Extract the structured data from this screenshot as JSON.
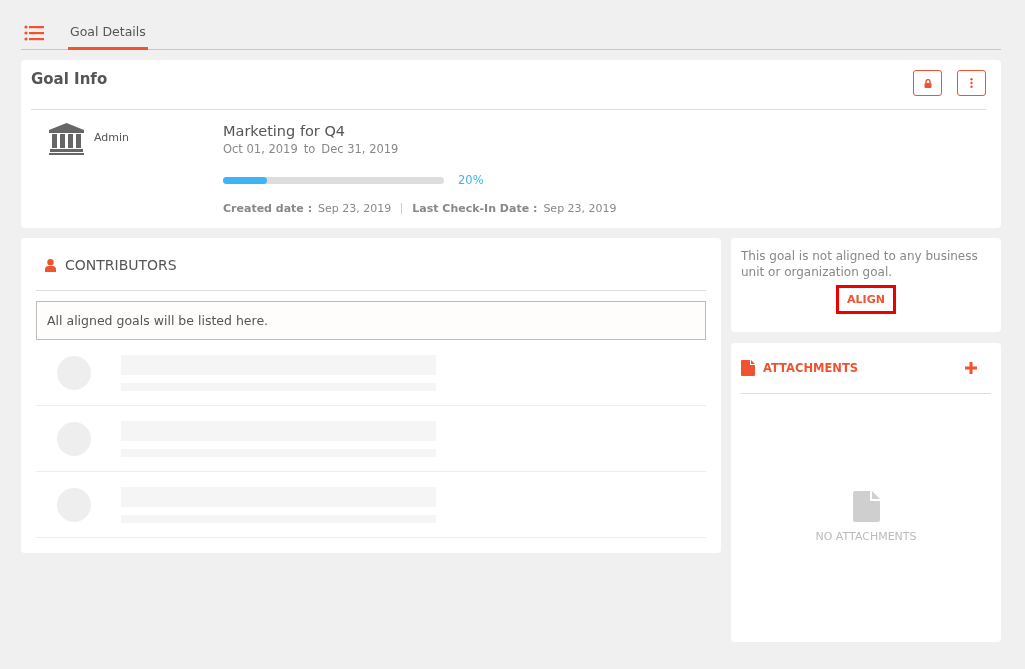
{
  "tabs": [
    {
      "label": "Goal Details",
      "selected": true
    }
  ],
  "goal_info": {
    "title": "Goal Info",
    "owner": "Admin",
    "goal_name": "Marketing for Q4",
    "start_date": "Oct 01, 2019",
    "date_separator": "to",
    "end_date": "Dec 31, 2019",
    "progress": {
      "level": 0.2,
      "reading": "20%"
    },
    "created_label": "Created date :",
    "created_date": "Sep 23, 2019",
    "checkin_label": "Last Check-In Date :",
    "checkin_date": "Sep 23, 2019"
  },
  "contributors": {
    "title": "CONTRIBUTORS",
    "notice": "All aligned goals will be listed here."
  },
  "alignment": {
    "message": "This goal is not aligned to any business unit or organization goal.",
    "button": "ALIGN"
  },
  "attachments": {
    "title": "ATTACHMENTS",
    "empty_text": "NO ATTACHMENTS"
  }
}
